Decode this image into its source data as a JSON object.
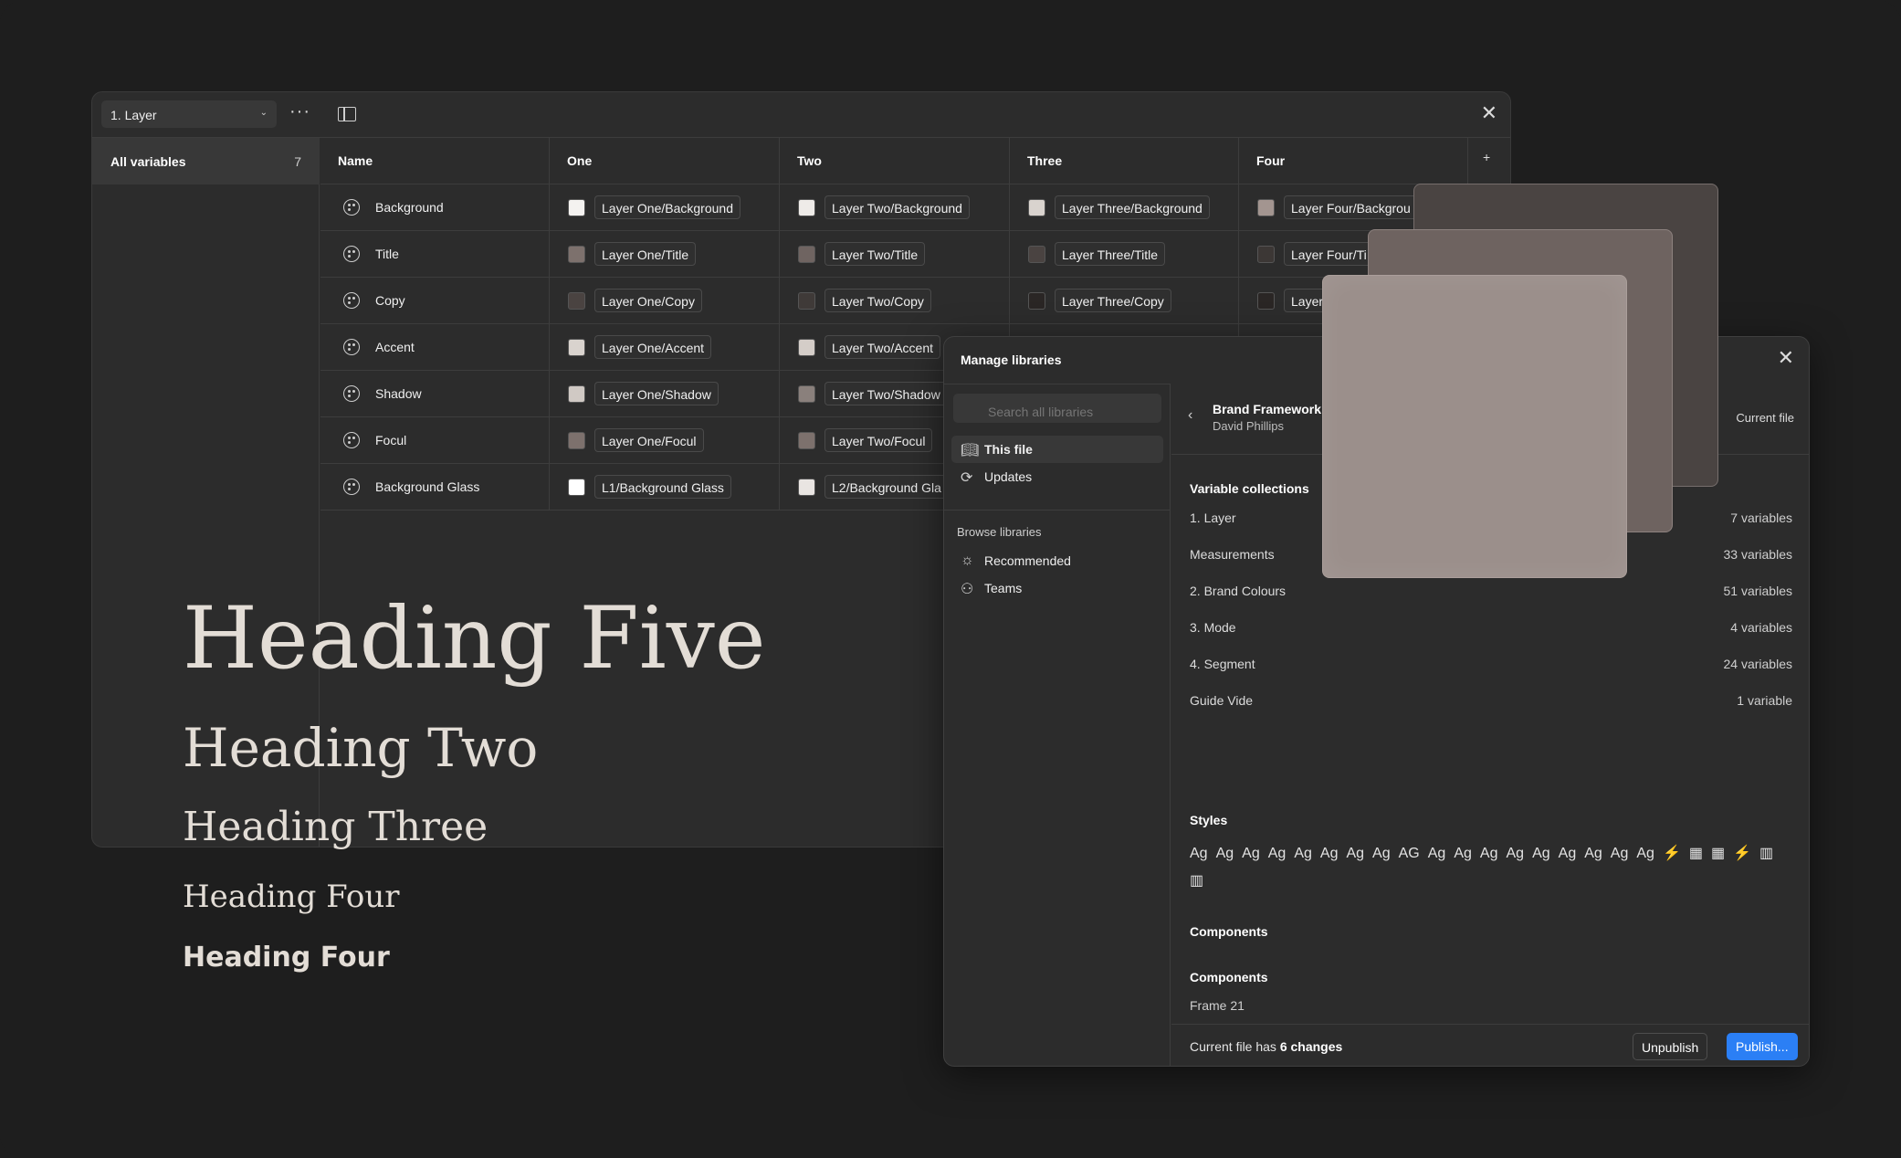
{
  "variables_window": {
    "collection_select": "1. Layer",
    "sidebar": {
      "all_variables_label": "All variables",
      "all_variables_count": "7"
    },
    "columns": [
      "Name",
      "One",
      "Two",
      "Three",
      "Four"
    ],
    "rows": [
      {
        "name": "Background",
        "one": "Layer One/Background",
        "two": "Layer Two/Background",
        "three": "Layer Three/Background",
        "four": "Layer Four/Backgrou",
        "colors": [
          "#f4f2f0",
          "#eeebe8",
          "#d9d3ce",
          "#a39590"
        ]
      },
      {
        "name": "Title",
        "one": "Layer One/Title",
        "two": "Layer Two/Title",
        "three": "Layer Three/Title",
        "four": "Layer Four/Ti",
        "colors": [
          "#7d716d",
          "#6f6461",
          "#4a4341",
          "#3c3735"
        ]
      },
      {
        "name": "Copy",
        "one": "Layer One/Copy",
        "two": "Layer Two/Copy",
        "three": "Layer Three/Copy",
        "four": "Layer",
        "colors": [
          "#4a4341",
          "#3f3a38",
          "#2a2625",
          "#2a2625"
        ]
      },
      {
        "name": "Accent",
        "one": "Layer One/Accent",
        "two": "Layer Two/Accent",
        "three": "",
        "four": "",
        "colors": [
          "#d9d3ce",
          "#d4cdc8",
          "",
          ""
        ]
      },
      {
        "name": "Shadow",
        "one": "Layer One/Shadow",
        "two": "Layer Two/Shadow",
        "three": "",
        "four": "",
        "colors": [
          "#d0c9c4",
          "#8a807c",
          "",
          ""
        ]
      },
      {
        "name": "Focul",
        "one": "Layer One/Focul",
        "two": "Layer Two/Focul",
        "three": "",
        "four": "",
        "colors": [
          "#7d716d",
          "#7d716d",
          "",
          ""
        ]
      },
      {
        "name": "Background Glass",
        "one": "L1/Background Glass",
        "two": "L2/Background Gla",
        "three": "",
        "four": "",
        "colors": [
          "#ffffff",
          "#e9e5e2",
          "",
          ""
        ]
      }
    ]
  },
  "headings": {
    "h5": "Heading Five",
    "h2": "Heading Two",
    "h3": "Heading Three",
    "h4a": "Heading Four",
    "h4b": "Heading Four"
  },
  "libraries": {
    "title": "Manage libraries",
    "search_placeholder": "Search all libraries",
    "nav": {
      "this_file": "This file",
      "updates": "Updates",
      "browse_label": "Browse libraries",
      "recommended": "Recommended",
      "teams": "Teams"
    },
    "library_name": "Brand Framework",
    "library_author": "David Phillips",
    "current_file_label": "Current file",
    "variable_collections_title": "Variable collections",
    "collections": [
      {
        "name": "1. Layer",
        "count": "7 variables"
      },
      {
        "name": "Measurements",
        "count": "33 variables"
      },
      {
        "name": "2. Brand Colours",
        "count": "51 variables"
      },
      {
        "name": "3. Mode",
        "count": "4 variables"
      },
      {
        "name": "4. Segment",
        "count": "24 variables"
      },
      {
        "name": "Guide Vide",
        "count": "1 variable"
      }
    ],
    "styles_title": "Styles",
    "style_glyphs": [
      "Ag",
      "Ag",
      "Ag",
      "Ag",
      "Ag",
      "Ag",
      "Ag",
      "Ag",
      "AG",
      "Ag",
      "Ag",
      "Ag",
      "Ag",
      "Ag",
      "Ag",
      "Ag",
      "Ag",
      "Ag",
      "⚡",
      "▦",
      "▦",
      "⚡",
      "▥",
      "▥"
    ],
    "components_title": "Components",
    "components_subtitle": "Components",
    "frame_label": "Frame 21",
    "footer": {
      "text_prefix": "Current file has ",
      "changes": "6 changes",
      "unpublish": "Unpublish",
      "publish": "Publish..."
    }
  }
}
